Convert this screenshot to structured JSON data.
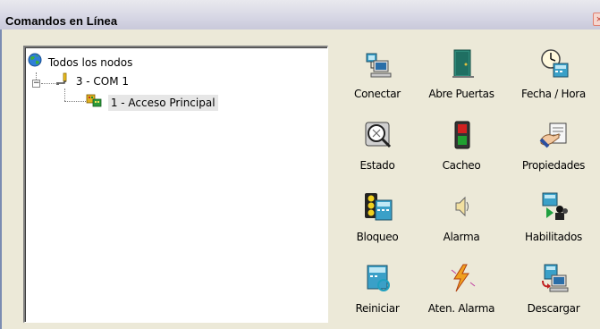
{
  "window": {
    "title": "Comandos en Línea",
    "close_glyph": "×"
  },
  "tree": {
    "root": {
      "label": "Todos los nodos",
      "icon": "globe-icon"
    },
    "port": {
      "label": "3 - COM 1",
      "icon": "serial-plug-icon",
      "expander": "−"
    },
    "node": {
      "label": "1 - Acceso Principal",
      "icon": "controller-node-icon"
    }
  },
  "commands": [
    {
      "label": "Conectar",
      "icon": "computer-network-icon"
    },
    {
      "label": "Abre Puertas",
      "icon": "door-icon"
    },
    {
      "label": "Fecha / Hora",
      "icon": "clock-icon"
    },
    {
      "label": "Estado",
      "icon": "magnifier-icon"
    },
    {
      "label": "Cacheo",
      "icon": "signal-light-icon"
    },
    {
      "label": "Propiedades",
      "icon": "hand-document-icon"
    },
    {
      "label": "Bloqueo",
      "icon": "traffic-light-icon"
    },
    {
      "label": "Alarma",
      "icon": "speaker-icon"
    },
    {
      "label": "Habilitados",
      "icon": "users-icon"
    },
    {
      "label": "Reiniciar",
      "icon": "restart-icon"
    },
    {
      "label": "Aten. Alarma",
      "icon": "lightning-icon"
    },
    {
      "label": "Descargar",
      "icon": "download-computer-icon"
    }
  ]
}
